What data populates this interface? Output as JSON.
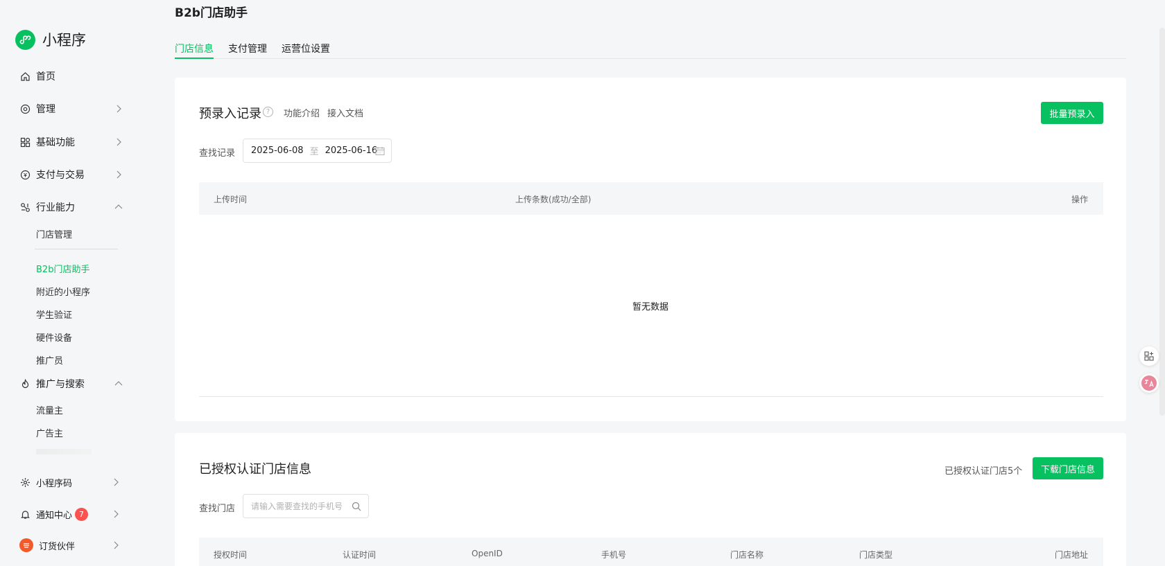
{
  "app": {
    "logo_text": "小程序"
  },
  "page_title": "B2b门店助手",
  "sidebar": {
    "items": [
      {
        "label": "首页"
      },
      {
        "label": "管理"
      },
      {
        "label": "基础功能"
      },
      {
        "label": "支付与交易"
      },
      {
        "label": "行业能力"
      },
      {
        "label": "推广与搜索"
      },
      {
        "label": "小程序码"
      },
      {
        "label": "通知中心"
      },
      {
        "label": "订货伙伴"
      }
    ],
    "industry_sub": [
      {
        "label": "门店管理"
      },
      {
        "label": "B2b门店助手"
      },
      {
        "label": "附近的小程序"
      },
      {
        "label": "学生验证"
      },
      {
        "label": "硬件设备"
      },
      {
        "label": "推广员"
      }
    ],
    "promo_sub": [
      {
        "label": "流量主"
      },
      {
        "label": "广告主"
      }
    ],
    "notification_count": "7"
  },
  "tabs": [
    {
      "label": "门店信息"
    },
    {
      "label": "支付管理"
    },
    {
      "label": "运营位设置"
    }
  ],
  "records": {
    "title": "预录入记录",
    "link_intro": "功能介绍",
    "link_docs": "接入文档",
    "batch_button": "批量预录入",
    "search_label": "查找记录",
    "date_start": "2025-06-08",
    "date_sep": "至",
    "date_end": "2025-06-16",
    "columns": [
      "上传时间",
      "上传条数(成功/全部)",
      "操作"
    ],
    "empty_text": "暂无数据"
  },
  "stores": {
    "title": "已授权认证门店信息",
    "count_text": "已授权认证门店5个",
    "download_button": "下载门店信息",
    "search_label": "查找门店",
    "search_placeholder": "请输入需要查找的手机号",
    "columns": [
      "授权时间",
      "认证时间",
      "OpenID",
      "手机号",
      "门店名称",
      "门店类型",
      "门店地址"
    ]
  },
  "colors": {
    "accent": "#07c160",
    "badge": "#fa5151"
  }
}
